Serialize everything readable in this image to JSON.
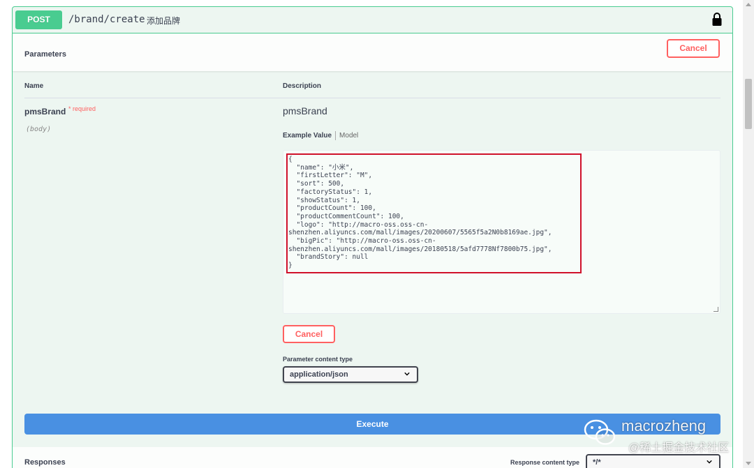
{
  "operation": {
    "method": "POST",
    "path": "/brand/create",
    "summary": "添加品牌"
  },
  "parameters": {
    "title": "Parameters",
    "cancel_label": "Cancel",
    "col_name": "Name",
    "col_description": "Description",
    "param": {
      "name": "pmsBrand",
      "required_mark": "* required",
      "location": "(body)",
      "description": "pmsBrand"
    },
    "tabs": {
      "example": "Example Value",
      "model": "Model"
    },
    "body_code": "{\n  \"name\": \"小米\",\n  \"firstLetter\": \"M\",\n  \"sort\": 500,\n  \"factoryStatus\": 1,\n  \"showStatus\": 1,\n  \"productCount\": 100,\n  \"productCommentCount\": 100,\n  \"logo\": \"http://macro-oss.oss-cn-\nshenzhen.aliyuncs.com/mall/images/20200607/5565f5a2N0b8169ae.jpg\",\n  \"bigPic\": \"http://macro-oss.oss-cn-\nshenzhen.aliyuncs.com/mall/images/20180518/5afd7778Nf7800b75.jpg\",\n  \"brandStory\": null\n}",
    "cancel_label_2": "Cancel",
    "content_type_label": "Parameter content type",
    "content_type_value": "application/json"
  },
  "execute_label": "Execute",
  "responses": {
    "title": "Responses",
    "content_type_label": "Response content type",
    "content_type_value": "*/*"
  },
  "watermark": {
    "name": "macrozheng",
    "site": "@稀土掘金技术社区"
  },
  "icons": {
    "lock": "lock-icon",
    "chevron": "chevron-down-icon",
    "wechat": "wechat-icon"
  },
  "colors": {
    "post": "#49cc90",
    "cancel": "#ff6060",
    "execute": "#4990e2",
    "highlight": "#d0102a"
  }
}
